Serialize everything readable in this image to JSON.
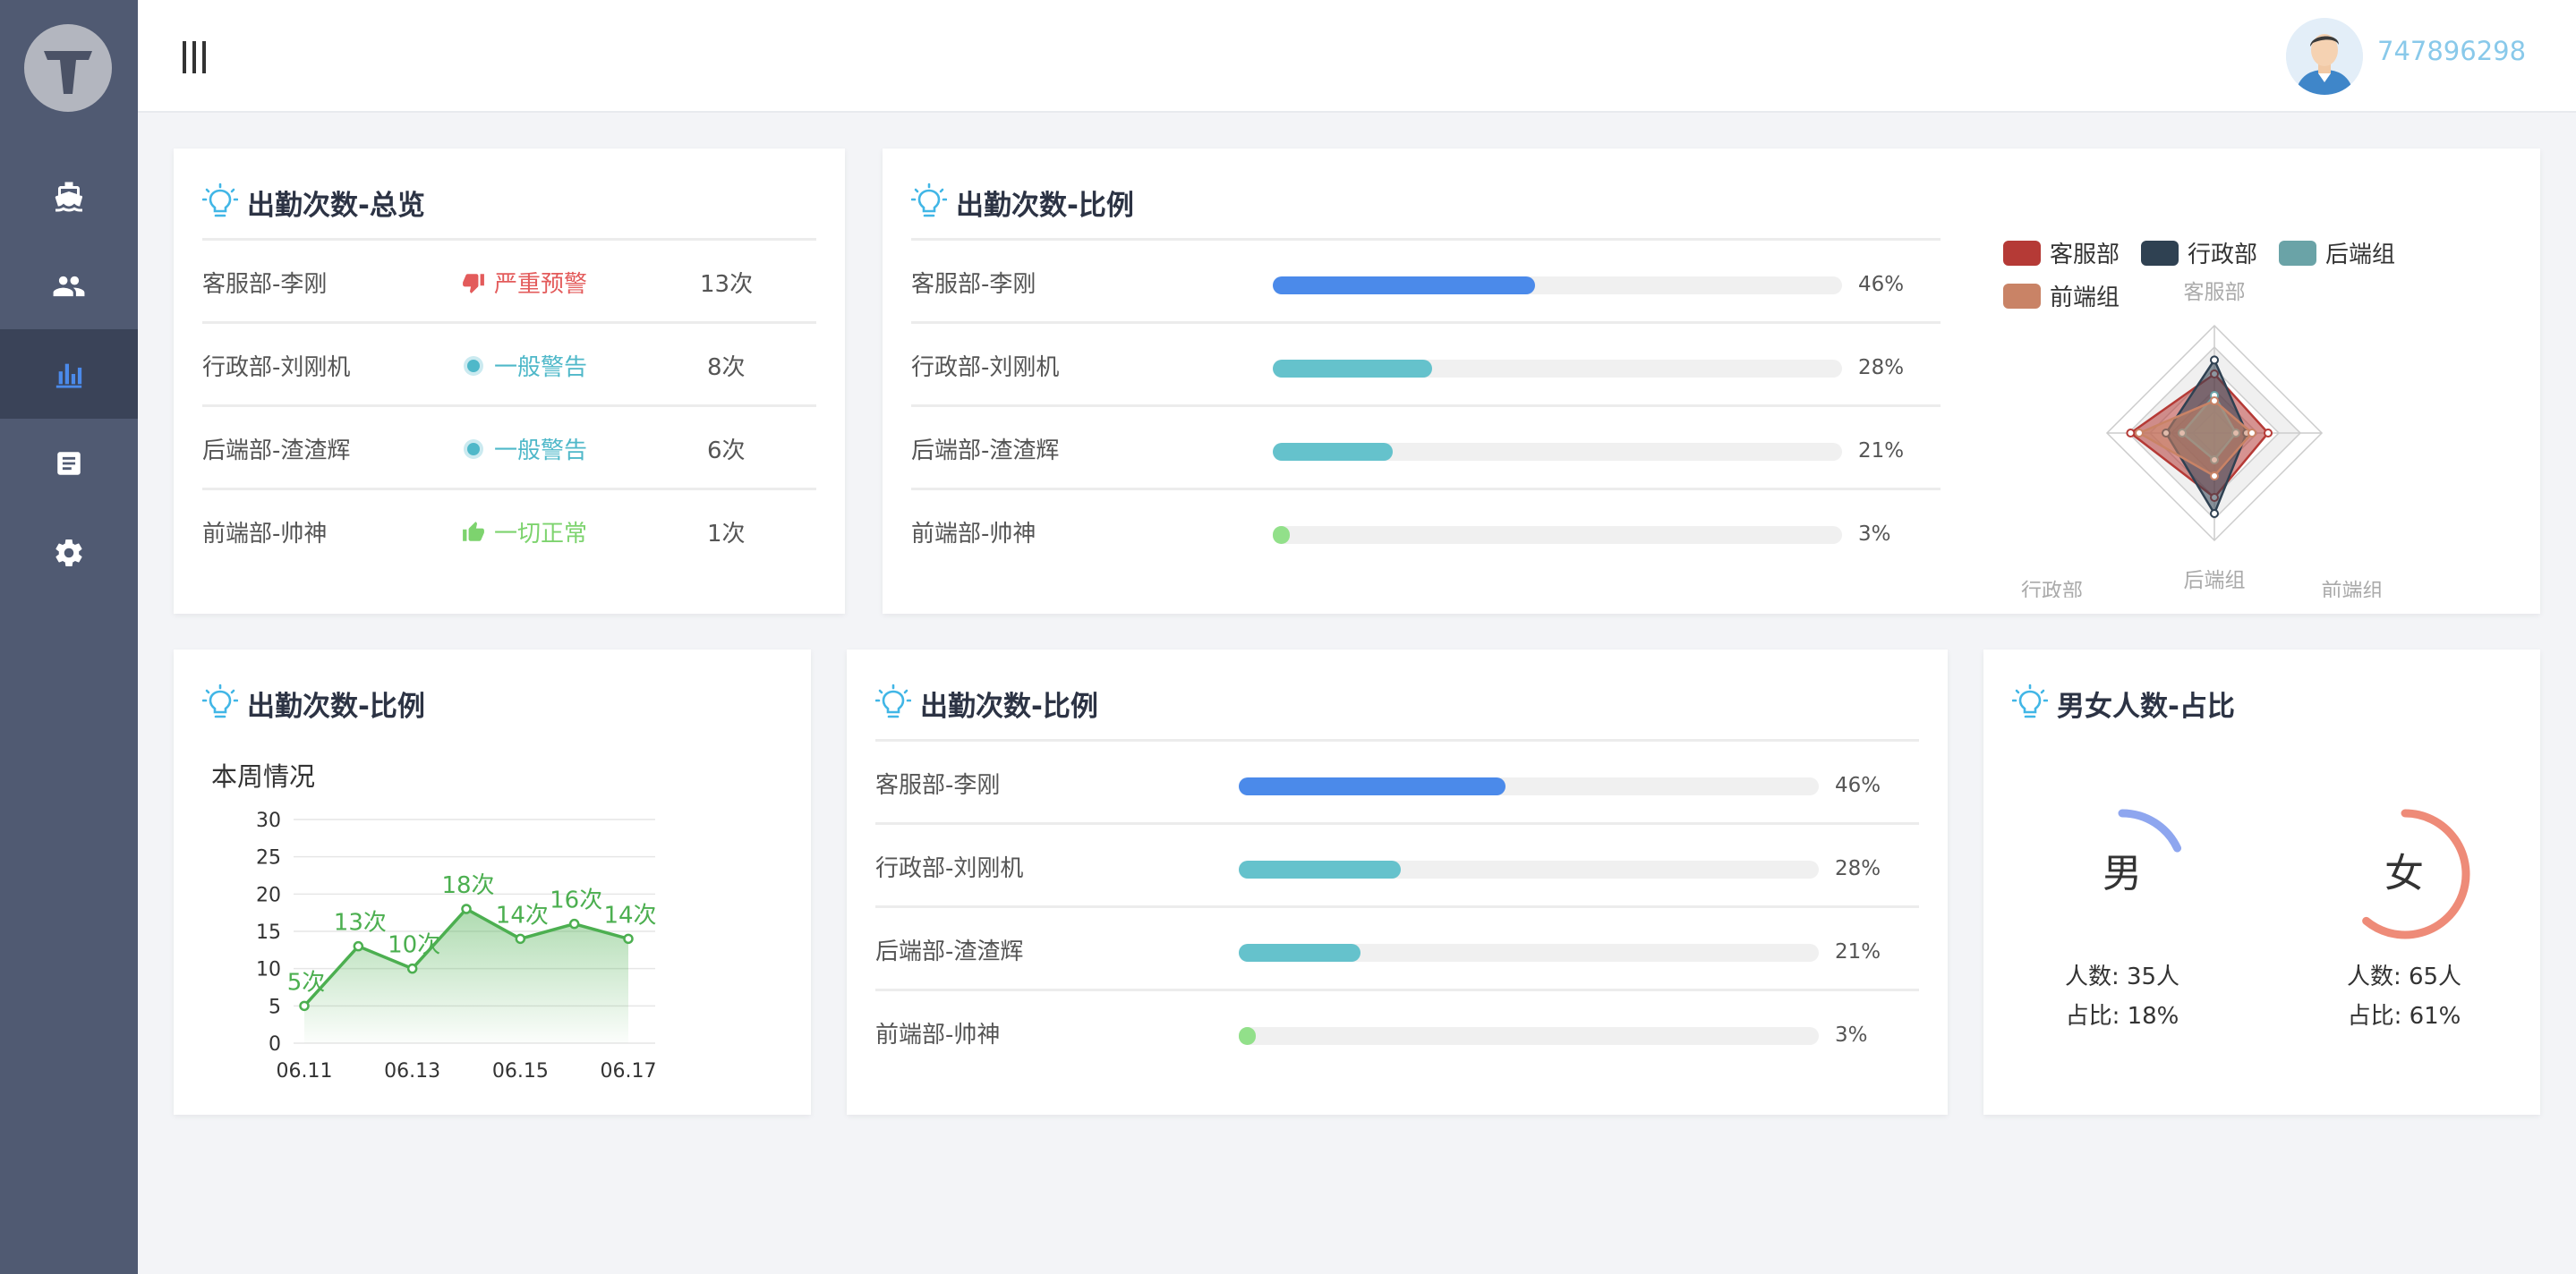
{
  "header": {
    "user_id": "747896298"
  },
  "sidebar": {
    "items": [
      {
        "icon": "ship-icon",
        "active": false
      },
      {
        "icon": "users-icon",
        "active": false
      },
      {
        "icon": "bar-chart-icon",
        "active": true
      },
      {
        "icon": "document-icon",
        "active": false
      },
      {
        "icon": "gear-icon",
        "active": false
      }
    ]
  },
  "overview": {
    "title": "出勤次数-总览",
    "rows": [
      {
        "name": "客服部-李刚",
        "status": "严重预警",
        "status_color": "#e35b5b",
        "status_icon": "thumbs-down-icon",
        "count": "13次"
      },
      {
        "name": "行政部-刘刚机",
        "status": "一般警告",
        "status_color": "#4fb8c9",
        "status_icon": "dot-icon",
        "count": "8次"
      },
      {
        "name": "后端部-渣渣辉",
        "status": "一般警告",
        "status_color": "#4fb8c9",
        "status_icon": "dot-icon",
        "count": "6次"
      },
      {
        "name": "前端部-帅神",
        "status": "一切正常",
        "status_color": "#7dd36e",
        "status_icon": "thumbs-up-icon",
        "count": "1次"
      }
    ]
  },
  "ratio_top": {
    "title": "出勤次数-比例",
    "rows": [
      {
        "name": "客服部-李刚",
        "pct": "46%",
        "value": 0.46,
        "color": "#4b8aea"
      },
      {
        "name": "行政部-刘刚机",
        "pct": "28%",
        "value": 0.28,
        "color": "#65c2cc"
      },
      {
        "name": "后端部-渣渣辉",
        "pct": "21%",
        "value": 0.21,
        "color": "#65c2cc"
      },
      {
        "name": "前端部-帅神",
        "pct": "3%",
        "value": 0.03,
        "color": "#92e08a"
      }
    ]
  },
  "radar": {
    "legend": [
      {
        "name": "客服部",
        "color": "#b53a36"
      },
      {
        "name": "行政部",
        "color": "#2f4152"
      },
      {
        "name": "后端组",
        "color": "#6aa3a7"
      },
      {
        "name": "前端组",
        "color": "#c98366"
      }
    ],
    "axes": [
      "客服部",
      "前端组",
      "后端组",
      "行政部"
    ]
  },
  "week": {
    "title": "出勤次数-比例",
    "subtitle": "本周情况"
  },
  "ratio_bottom": {
    "title": "出勤次数-比例",
    "rows": [
      {
        "name": "客服部-李刚",
        "pct": "46%",
        "value": 0.46,
        "color": "#4b8aea"
      },
      {
        "name": "行政部-刘刚机",
        "pct": "28%",
        "value": 0.28,
        "color": "#65c2cc"
      },
      {
        "name": "后端部-渣渣辉",
        "pct": "21%",
        "value": 0.21,
        "color": "#65c2cc"
      },
      {
        "name": "前端部-帅神",
        "pct": "3%",
        "value": 0.03,
        "color": "#92e08a"
      }
    ]
  },
  "gender": {
    "title": "男女人数-占比",
    "male": {
      "char": "男",
      "count": "人数: 35人",
      "ratio": "占比: 18%",
      "value": 0.18,
      "color": "#8ea6ef"
    },
    "female": {
      "char": "女",
      "count": "人数: 65人",
      "ratio": "占比: 61%",
      "value": 0.61,
      "color": "#ee8b78"
    }
  },
  "chart_data": [
    {
      "type": "radar",
      "indicators": [
        "客服部",
        "前端组",
        "后端组",
        "行政部"
      ],
      "series": [
        {
          "name": "客服部",
          "values": [
            0.55,
            0.5,
            0.6,
            0.78
          ]
        },
        {
          "name": "行政部",
          "values": [
            0.68,
            0.3,
            0.75,
            0.45
          ]
        },
        {
          "name": "后端组",
          "values": [
            0.35,
            0.2,
            0.25,
            0.3
          ]
        },
        {
          "name": "前端组",
          "values": [
            0.3,
            0.35,
            0.4,
            0.7
          ]
        }
      ]
    },
    {
      "type": "area",
      "title": "本周情况",
      "x": [
        "06.11",
        "06.12",
        "06.13",
        "06.14",
        "06.15",
        "06.16",
        "06.17"
      ],
      "x_tick_labels": [
        "06.11",
        "06.13",
        "06.15",
        "06.17"
      ],
      "values": [
        5,
        13,
        10,
        18,
        14,
        16,
        14
      ],
      "data_labels": [
        "5次",
        "13次",
        "10次",
        "18次",
        "14次",
        "16次",
        "14次"
      ],
      "y_ticks": [
        0,
        5,
        10,
        15,
        20,
        25,
        30
      ],
      "ylim": [
        0,
        30
      ],
      "color": "#4caf50",
      "grid": true
    }
  ]
}
